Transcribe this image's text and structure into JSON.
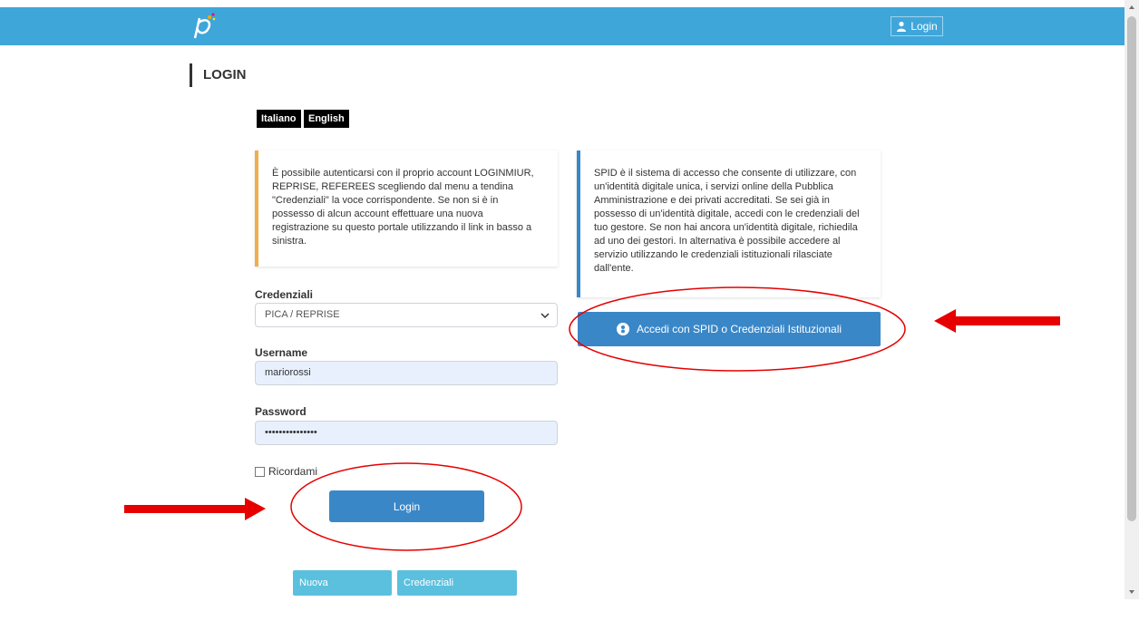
{
  "navbar": {
    "login_label": "Login",
    "brand_color": "#3fa6da",
    "logo_icon": "pica-logo",
    "user_icon": "user-icon"
  },
  "page": {
    "title": "LOGIN"
  },
  "languages": {
    "italian": "Italiano",
    "english": "English"
  },
  "info_left": {
    "text": "È possibile autenticarsi con il proprio account LOGINMIUR, REPRISE, REFEREES scegliendo dal menu a tendina \"Credenziali\" la voce corrispondente. Se non si è in possesso di alcun account effettuare una nuova registrazione su questo portale utilizzando il link in basso a sinistra.",
    "accent": "#f0ad4e"
  },
  "info_right": {
    "text": "SPID è il sistema di accesso che consente di utilizzare, con un'identità digitale unica, i servizi online della Pubblica Amministrazione e dei privati accreditati. Se sei già in possesso di un'identità digitale, accedi con le credenziali del tuo gestore. Se non hai ancora un'identità digitale, richiedila ad uno dei gestori. In alternativa è possibile accedere al servizio utilizzando le credenziali istituzionali rilasciate dall'ente.",
    "accent": "#3a87c8"
  },
  "form": {
    "credentials_label": "Credenziali",
    "credentials_value": "PICA / REPRISE",
    "username_label": "Username",
    "username_value": "mariorossi",
    "password_label": "Password",
    "password_value": "•••••••••••••••",
    "remember_label": "Ricordami",
    "login_button": "Login"
  },
  "spid": {
    "button_label": "Accedi con SPID o Credenziali Istituzionali",
    "icon": "spid-person-icon"
  },
  "footer_buttons": {
    "register": "Nuova registrazione",
    "forgot": "Credenziali dimenticate?"
  },
  "annotation_color": "#e60000"
}
